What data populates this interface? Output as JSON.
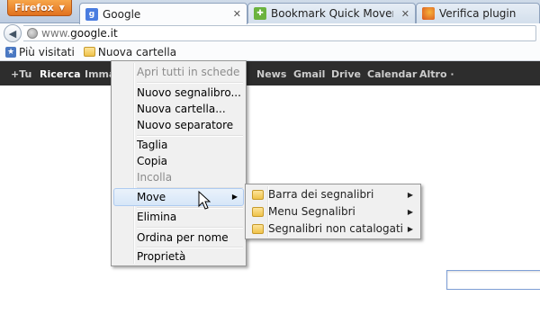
{
  "firefox_button": {
    "label": "Firefox",
    "caret": "▼"
  },
  "tabs": [
    {
      "label": "Google",
      "icon": "google-favicon",
      "close": "✕"
    },
    {
      "label": "Bookmark Quick Mover :: Add...",
      "icon": "puzzle-favicon",
      "close": "✕"
    },
    {
      "label": "Verifica plugin",
      "icon": "firefox-favicon"
    }
  ],
  "navbar": {
    "back_glyph": "◀",
    "url_prefix": "www.",
    "url_domain": "google.it"
  },
  "bookmarks_bar": {
    "items": [
      {
        "label": "Più visitati",
        "icon": "most-visited-icon"
      },
      {
        "label": "Nuova cartella",
        "icon": "folder-icon"
      }
    ]
  },
  "google_bar": {
    "items": [
      "+Tu",
      "Ricerca",
      "Immag",
      "News",
      "Gmail",
      "Drive",
      "Calendar",
      "Altro ·"
    ]
  },
  "context_menu": {
    "items": [
      {
        "label": "Apri tutti in schede",
        "disabled": true
      },
      {
        "label": "Nuovo segnalibro..."
      },
      {
        "label": "Nuova cartella..."
      },
      {
        "label": "Nuovo separatore"
      },
      {
        "label": "Taglia"
      },
      {
        "label": "Copia"
      },
      {
        "label": "Incolla",
        "disabled": true
      },
      {
        "label": "Move",
        "submenu": true,
        "arrow": "▶"
      },
      {
        "label": "Elimina"
      },
      {
        "label": "Ordina per nome"
      },
      {
        "label": "Proprietà"
      }
    ]
  },
  "submenu": {
    "items": [
      {
        "label": "Barra dei segnalibri",
        "arrow": "▶"
      },
      {
        "label": "Menu Segnalibri",
        "arrow": "▶"
      },
      {
        "label": "Segnalibri non catalogati",
        "arrow": "▶"
      }
    ]
  },
  "colors": {
    "firefox_orange": "#e1711e",
    "google_bar": "#2d2d2d",
    "menu_bg": "#f0f0f0",
    "hover_blue": "#d6e6f8"
  }
}
